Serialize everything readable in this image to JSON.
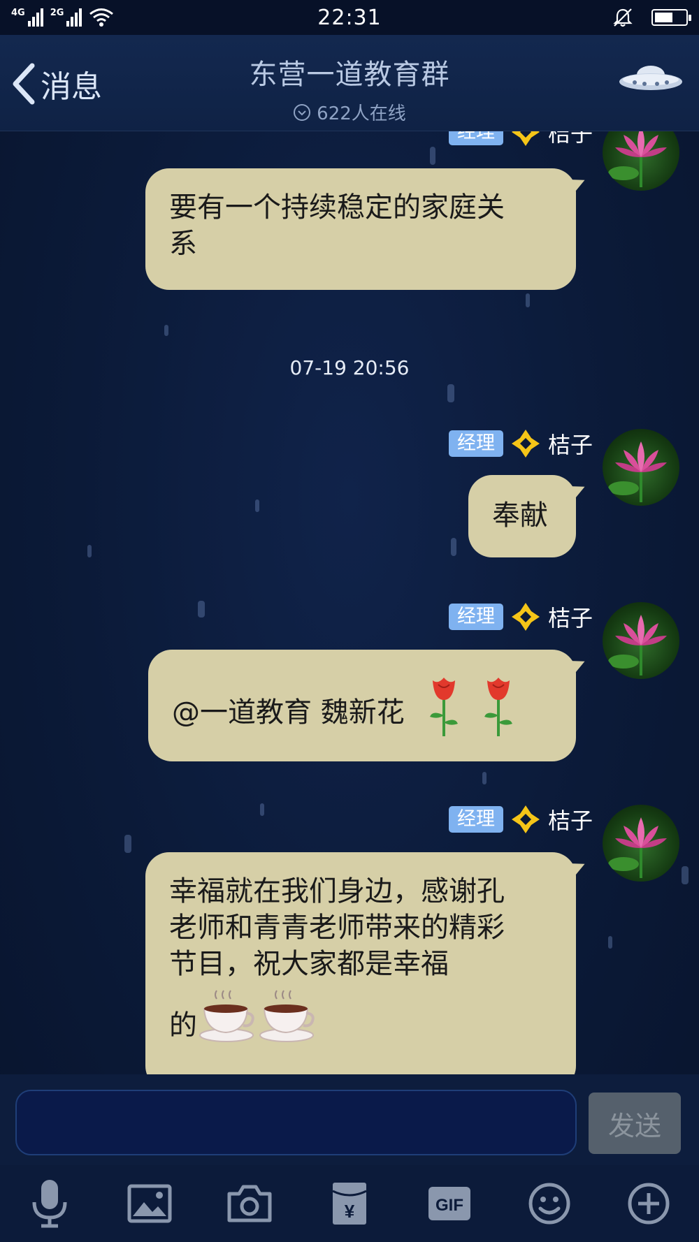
{
  "status_bar": {
    "net1": "4G",
    "net2": "2G",
    "time": "22:31"
  },
  "header": {
    "back_label": "消息",
    "group_title": "东营一道教育群",
    "online_text": "622人在线"
  },
  "chat": {
    "messages": [
      {
        "role": "经理",
        "sender": "桔子",
        "text_lines": [
          "要有一个持续稳定的家庭关",
          "系"
        ]
      },
      {
        "timestamp": "07-19 20:56"
      },
      {
        "role": "经理",
        "sender": "桔子",
        "text": "奉献"
      },
      {
        "role": "经理",
        "sender": "桔子",
        "text": "@一道教育 魏新花",
        "emoji": [
          "rose",
          "rose"
        ]
      },
      {
        "role": "经理",
        "sender": "桔子",
        "text_lines": [
          "幸福就在我们身边，感谢孔",
          "老师和青青老师带来的精彩",
          "节目，祝大家都是幸福",
          "的"
        ],
        "emoji": [
          "coffee",
          "coffee"
        ]
      }
    ]
  },
  "input": {
    "value": "",
    "send_label": "发送"
  },
  "toolbar": {
    "items": [
      "voice-icon",
      "image-icon",
      "camera-icon",
      "red-packet-icon",
      "gif-icon",
      "emoji-icon",
      "plus-icon"
    ],
    "gif_label": "GIF",
    "yuan_symbol": "¥"
  },
  "colors": {
    "bubble": "#d6cfa7",
    "role_badge": "#7fb2f0",
    "background": "#0c1a36",
    "diamond": "#f5c518"
  }
}
